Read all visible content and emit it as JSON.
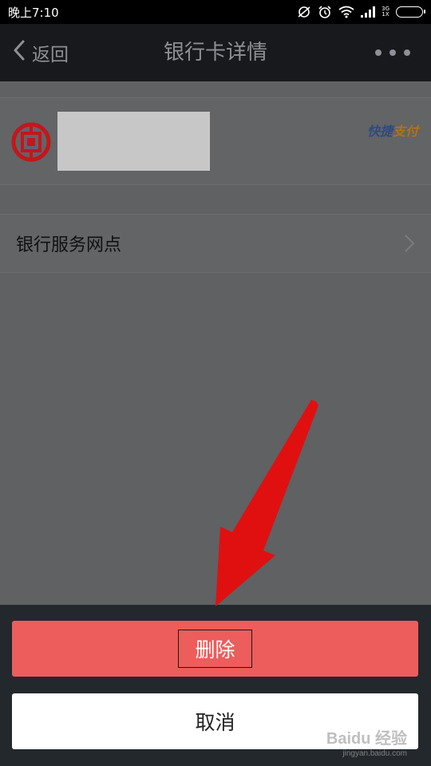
{
  "status_bar": {
    "time": "晚上7:10",
    "network_top": "3G",
    "network_bottom": "1X"
  },
  "nav": {
    "back_label": "返回",
    "title": "银行卡详情"
  },
  "card": {
    "badge_part1": "快捷",
    "badge_part2": "支付"
  },
  "service": {
    "label": "银行服务网点"
  },
  "action_sheet": {
    "delete_label": "删除",
    "cancel_label": "取消"
  },
  "watermark": {
    "brand": "Baidu 经验",
    "url": "jingyan.baidu.com"
  },
  "colors": {
    "delete": "#ec5d5b",
    "arrow": "#e01010",
    "bank_logo": "#c4161c"
  }
}
